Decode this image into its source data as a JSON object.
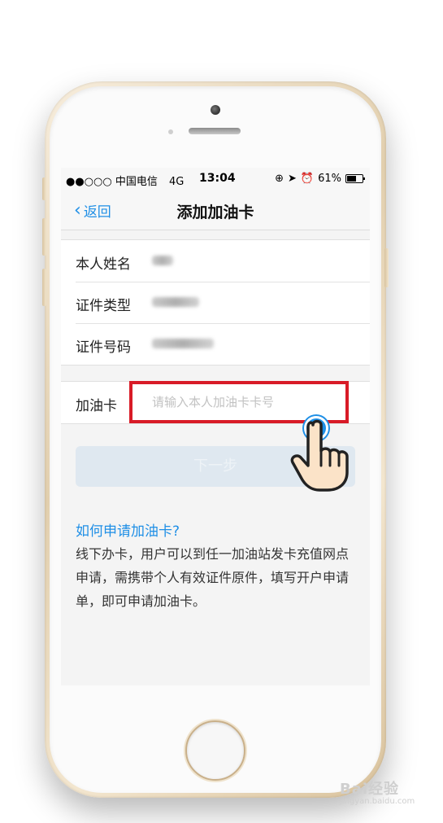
{
  "status_bar": {
    "carrier": "●●○○○ 中国电信",
    "network": "4G",
    "time": "13:04",
    "battery": "61%"
  },
  "nav": {
    "back_label": "返回",
    "title": "添加加油卡"
  },
  "form": {
    "name_label": "本人姓名",
    "id_type_label": "证件类型",
    "id_number_label": "证件号码",
    "card_label": "加油卡",
    "card_placeholder": "请输入本人加油卡卡号"
  },
  "next_button": "下一步",
  "help": {
    "title": "如何申请加油卡?",
    "body": "线下办卡，用户可以到任一加油站发卡充值网点申请，需携带个人有效证件原件，填写开户申请单，即可申请加油卡。"
  },
  "watermark": {
    "main": "Bai经验",
    "sub": "jingyan.baidu.com"
  },
  "colors": {
    "accent": "#1f8fe6",
    "highlight": "#d81b27"
  }
}
